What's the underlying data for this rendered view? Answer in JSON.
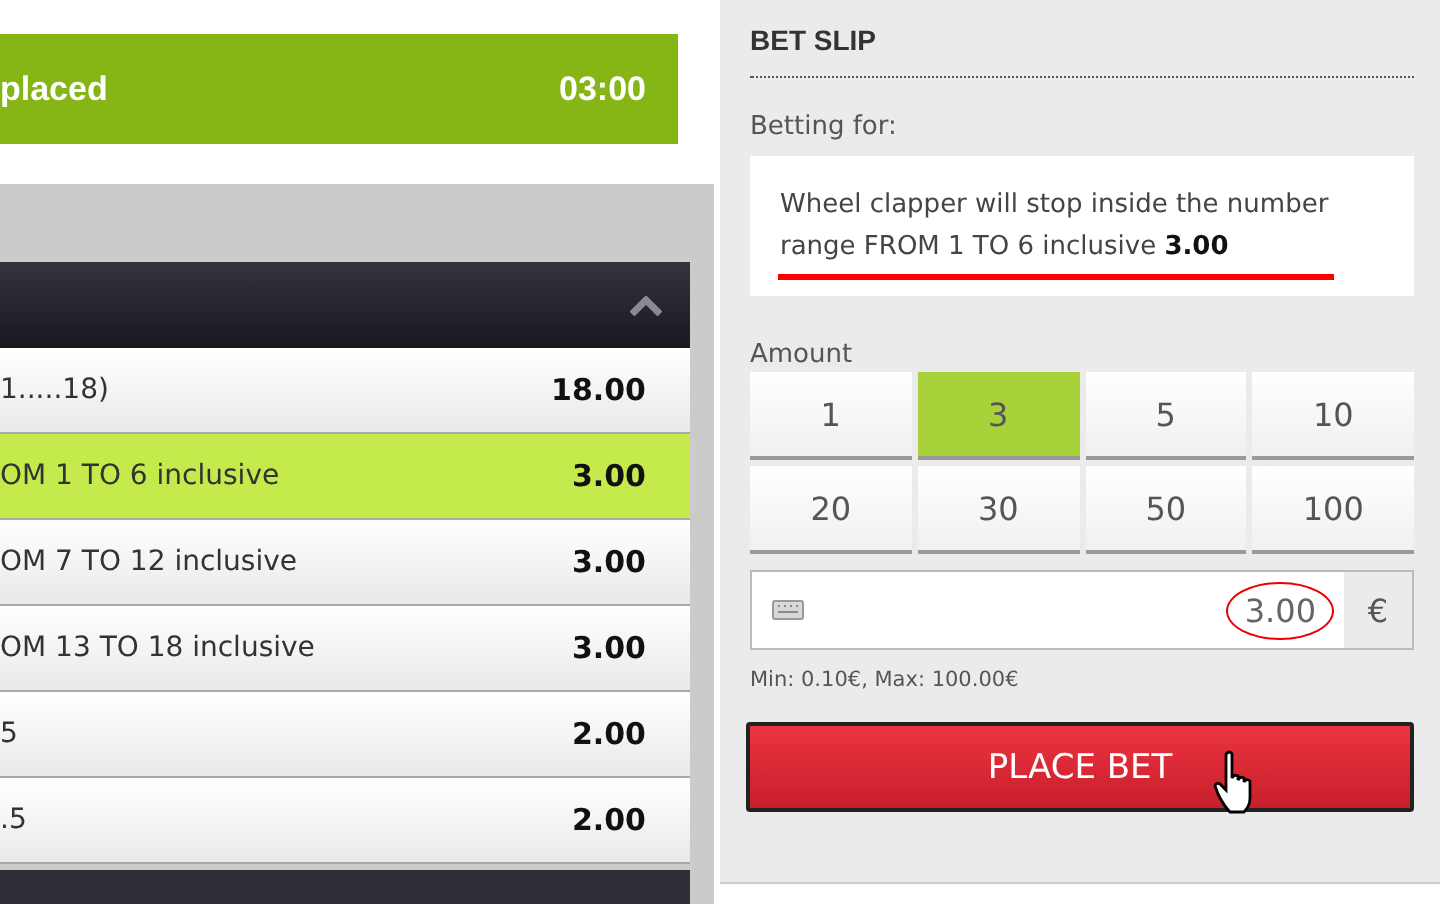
{
  "status_bar": {
    "label": "placed",
    "timer": "03:00"
  },
  "market": {
    "rows": [
      {
        "label": "1.....18)",
        "odds": "18.00",
        "selected": false
      },
      {
        "label": "OM 1 TO 6 inclusive",
        "odds": "3.00",
        "selected": true
      },
      {
        "label": "OM 7 TO 12 inclusive",
        "odds": "3.00",
        "selected": false
      },
      {
        "label": "OM 13 TO 18 inclusive",
        "odds": "3.00",
        "selected": false
      },
      {
        "label": "5",
        "odds": "2.00",
        "selected": false
      },
      {
        "label": ".5",
        "odds": "2.00",
        "selected": false
      }
    ]
  },
  "bet_slip": {
    "title": "BET SLIP",
    "betting_for_label": "Betting for:",
    "selection": "Wheel clapper will stop inside the number range FROM 1 TO 6 inclusive **3.00**",
    "amount_label": "Amount",
    "amounts": [
      {
        "label": "1",
        "selected": false
      },
      {
        "label": "3",
        "selected": true
      },
      {
        "label": "5",
        "selected": false
      },
      {
        "label": "10",
        "selected": false
      },
      {
        "label": "20",
        "selected": false
      },
      {
        "label": "30",
        "selected": false
      },
      {
        "label": "50",
        "selected": false
      },
      {
        "label": "100",
        "selected": false
      }
    ],
    "stake": {
      "value": "3.00",
      "currency": "€"
    },
    "limits": "Min: 0.10€, Max: 100.00€",
    "place_button": "PLACE BET"
  }
}
